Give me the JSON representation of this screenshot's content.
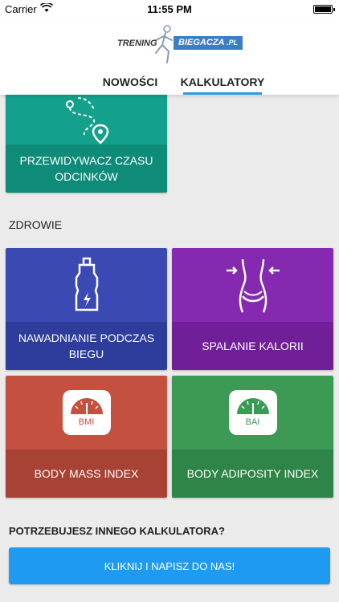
{
  "status_bar": {
    "carrier": "Carrier",
    "time": "11:55 PM"
  },
  "logo": {
    "part1": "TRENING",
    "part2": "BIEGACZA",
    "part3": ".PL"
  },
  "tabs": [
    {
      "label": "NOWOŚCI"
    },
    {
      "label": "KALKULATORY"
    }
  ],
  "tiles": {
    "route": {
      "label": "PRZEWIDYWACZ CZASU ODCINKÓW",
      "icon": "route-map-pin-icon",
      "color_top": "#13a08c",
      "color_bottom": "#0e8b79"
    },
    "hydration": {
      "label": "NAWADNIANIE PODCZAS BIEGU",
      "icon": "water-bottle-icon",
      "color_top": "#3b49b3",
      "color_bottom": "#2e3c9c"
    },
    "calories": {
      "label": "SPALANIE KALORII",
      "icon": "waist-slimming-icon",
      "color_top": "#8429b0",
      "color_bottom": "#711f98"
    },
    "bmi": {
      "label": "BODY MASS INDEX",
      "scale_text": "BMI",
      "icon": "scale-icon",
      "color_top": "#c4503f",
      "color_bottom": "#a84234"
    },
    "bai": {
      "label": "BODY ADIPOSITY INDEX",
      "scale_text": "BAI",
      "icon": "scale-icon",
      "color_top": "#3c9a55",
      "color_bottom": "#2f8447"
    }
  },
  "sections": {
    "health": "ZDROWIE"
  },
  "footer": {
    "question": "POTRZEBUJESZ INNEGO KALKULATORA?",
    "cta_label": "KLIKNIJ I NAPISZ DO NAS!"
  },
  "colors": {
    "accent": "#2b9be6",
    "cta": "#1e9bf0"
  }
}
